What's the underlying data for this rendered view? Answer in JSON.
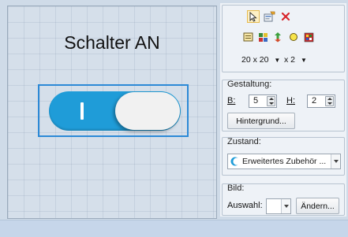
{
  "canvas": {
    "title": "Schalter AN",
    "toggle": {
      "state": "on",
      "on_mark": "I",
      "track_color": "#1f9cd8",
      "knob_color": "#f1f1f1",
      "selection_color": "#2c89d6"
    }
  },
  "toolbar": {
    "icons": [
      "select-pointer-icon",
      "edit-properties-icon",
      "delete-icon",
      "align-icon",
      "grid-icon",
      "order-icon",
      "circle-icon",
      "color-palette-icon"
    ],
    "grid_size": "20 x 20",
    "zoom": "x 2"
  },
  "design": {
    "label": "Gestaltung:",
    "width_label": "B:",
    "width_value": "5",
    "height_label": "H:",
    "height_value": "2",
    "background_button": "Hintergrund..."
  },
  "state": {
    "label": "Zustand:",
    "selected": "Erweitertes Zubehör ..."
  },
  "image": {
    "label": "Bild:",
    "choice_label": "Auswahl:",
    "choice_value": "",
    "change_button": "Ändern..."
  }
}
